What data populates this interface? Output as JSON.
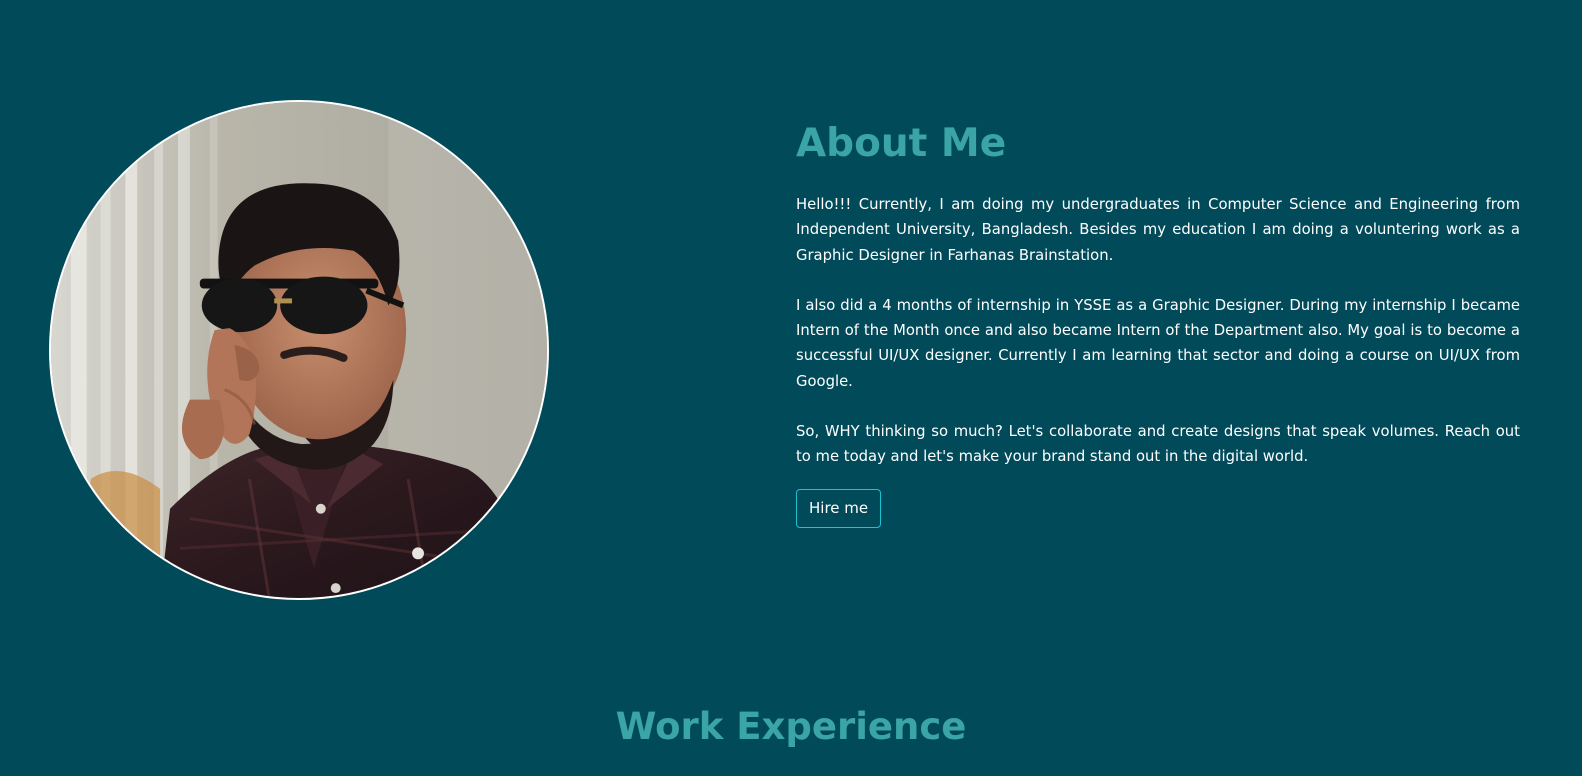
{
  "about": {
    "title": "About Me",
    "paragraphs": [
      "Hello!!! Currently, I am doing my undergraduates in Computer Science and Engineering from Independent University, Bangladesh. Besides my education I am doing a voluntering work as a Graphic Designer in Farhanas Brainstation.",
      "I also did a 4 months of internship in YSSE as a Graphic Designer. During my internship I became Intern of the Month once and also became Intern of the Department also. My goal is to become a successful UI/UX designer. Currently I am learning that sector and doing a course on UI/UX from Google.",
      "So, WHY thinking so much? Let's collaborate and create designs that speak volumes. Reach out to me today and let's make your brand stand out in the digital world."
    ],
    "button_label": "Hire me"
  },
  "work_experience": {
    "title": "Work Experience"
  },
  "colors": {
    "background": "#014a5a",
    "heading": "#3aa4a7",
    "button_border": "#19c3d0",
    "text": "#ffffff"
  }
}
